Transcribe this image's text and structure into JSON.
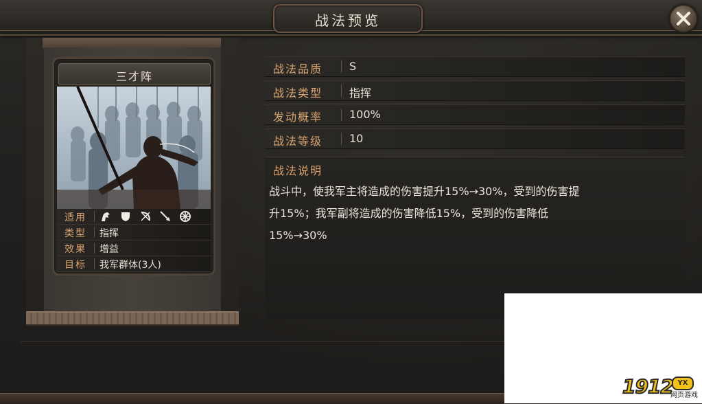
{
  "dialog": {
    "title": "战法预览",
    "close_icon": "close-icon"
  },
  "card": {
    "name": "三才阵",
    "attributes": [
      {
        "key": "适用",
        "icons": [
          "cavalry-icon",
          "shield-icon",
          "bow-icon",
          "spear-icon",
          "wheel-icon"
        ]
      },
      {
        "key": "类型",
        "value": "指挥"
      },
      {
        "key": "效果",
        "value": "增益"
      },
      {
        "key": "目标",
        "value": "我军群体(3人)"
      }
    ]
  },
  "info": {
    "rows": [
      {
        "key": "战法品质",
        "value": "S"
      },
      {
        "key": "战法类型",
        "value": "指挥"
      },
      {
        "key": "发动概率",
        "value": "100%"
      },
      {
        "key": "战法等级",
        "value": "10"
      }
    ],
    "description_label": "战法说明",
    "description_lines": [
      "战斗中，使我军主将造成的伤害提升15%→30%，受到的伤害提",
      "升15%；我军副将造成的伤害降低15%，受到的伤害降低",
      "15%→30%"
    ]
  },
  "watermark": {
    "digits": "1912",
    "badge": "YX",
    "sub": "网页游戏"
  },
  "colors": {
    "label_gold": "#d9a46f",
    "value_text": "#ece6da",
    "panel_bg": "#23211f",
    "border_brown": "#6a5443"
  }
}
